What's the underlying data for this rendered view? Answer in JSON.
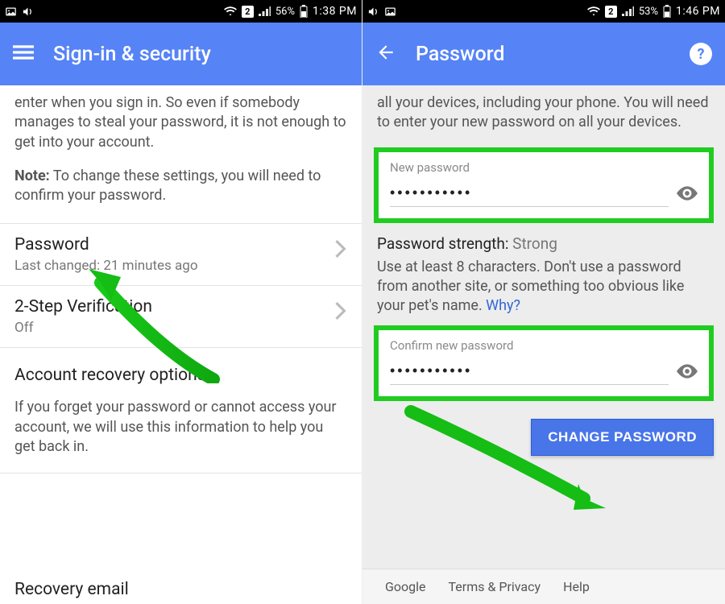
{
  "left": {
    "statusbar": {
      "battery": "56%",
      "time": "1:38 PM",
      "sim": "2"
    },
    "appbar": {
      "title": "Sign-in & security"
    },
    "intro_partial": "enter when you sign in. So even if somebody manages to steal your password, it is not enough to get into your account.",
    "note_label": "Note:",
    "note_text": " To change these settings, you will need to confirm your password.",
    "rows": {
      "password": {
        "title": "Password",
        "sub": "Last changed: 21 minutes ago"
      },
      "twostep": {
        "title": "2-Step Verification",
        "sub": "Off"
      }
    },
    "recovery": {
      "title": "Account recovery options",
      "text": "If you forget your password or cannot access your account, we will use this information to help you get back in."
    },
    "cut_bottom": "Recovery email"
  },
  "right": {
    "statusbar": {
      "battery": "53%",
      "time": "1:46 PM",
      "sim": "2"
    },
    "appbar": {
      "title": "Password"
    },
    "lead": "all your devices, including your phone. You will need to enter your new password on all your devices.",
    "fields": {
      "new": {
        "label": "New password",
        "value": "•••••••••••"
      },
      "confirm": {
        "label": "Confirm new password",
        "value": "•••••••••••"
      }
    },
    "strength": {
      "label": "Password strength:",
      "value": "Strong"
    },
    "advice": "Use at least 8 characters. Don't use a password from another site, or something too obvious like your pet's name. ",
    "why": "Why?",
    "change_btn": "CHANGE PASSWORD",
    "footer": {
      "google": "Google",
      "terms": "Terms & Privacy",
      "help": "Help"
    }
  }
}
